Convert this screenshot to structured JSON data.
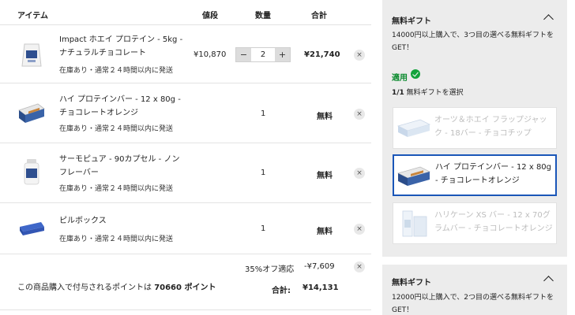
{
  "table": {
    "headers": {
      "item": "アイテム",
      "price": "値段",
      "qty": "数量",
      "total": "合計"
    }
  },
  "items": [
    {
      "name": "Impact ホエイ プロテイン - 5kg - ナチュラルチョコレート",
      "stock": "在庫あり・通常２４時間以内に発送",
      "price": "¥10,870",
      "qty": "2",
      "total": "¥21,740",
      "minus": "−",
      "plus": "+",
      "remove": "×"
    },
    {
      "name": "ハイ プロテインバー - 12 x 80g - チョコレートオレンジ",
      "stock": "在庫あり・通常２４時間以内に発送",
      "qty": "1",
      "total": "無料",
      "remove": "×"
    },
    {
      "name": "サーモピュア - 90カプセル - ノンフレーバー",
      "stock": "在庫あり・通常２４時間以内に発送",
      "qty": "1",
      "total": "無料",
      "remove": "×"
    },
    {
      "name": "ピルボックス",
      "stock": "在庫あり・通常２４時間以内に発送",
      "qty": "1",
      "total": "無料",
      "remove": "×"
    }
  ],
  "discount": {
    "label": "35%オフ適応",
    "value": "-¥7,609",
    "remove": "×"
  },
  "summary": {
    "points_prefix": "この商品購入で付与されるポイントは ",
    "points_value": "70660 ポイント",
    "total_label": "合計:",
    "total_value": "¥14,131"
  },
  "gift1": {
    "title": "無料ギフト",
    "desc": "14000円以上購入で、3つ目の選べる無料ギフトをGET！",
    "applied": "適用",
    "count": "1/1",
    "count_suffix": " 無料ギフトを選択",
    "options": [
      {
        "name": "オーツ＆ホエイ フラップジャック - 18バー - チョコチップ",
        "selected": false
      },
      {
        "name": "ハイ プロテインバー - 12 x 80g - チョコレートオレンジ",
        "selected": true
      },
      {
        "name": "ハリケーン XS バー - 12 x 70グラムバー - チョコレートオレンジ",
        "selected": false
      }
    ]
  },
  "gift2": {
    "title": "無料ギフト",
    "desc": "12000円以上購入で、2つ目の選べる無料ギフトをGET！"
  },
  "colors": {
    "accent": "#1a56b8",
    "success": "#12a33b",
    "panel": "#ececec"
  },
  "icons": [
    "protein-bag-icon",
    "protein-bar-box-icon",
    "capsule-bottle-icon",
    "pill-box-icon",
    "chevron-up-icon",
    "check-circle-icon",
    "remove-icon"
  ]
}
